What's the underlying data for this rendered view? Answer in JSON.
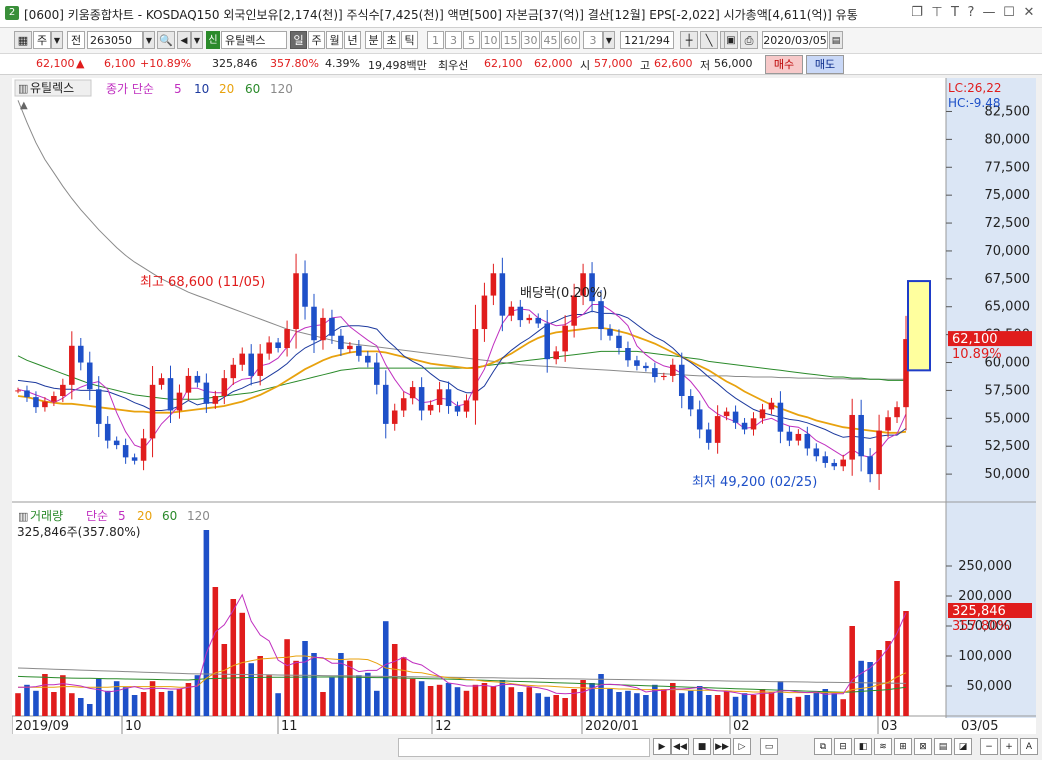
{
  "window": {
    "badge": "2",
    "title": "[0600] 키움종합차트 - KOSDAQ150 외국인보유[2,174(천)] 주식수[7,425(천)] 액면[500] 자본금[37(억)] 결산[12월] EPS[-2,022] 시가총액[4,611(억)] 유통"
  },
  "toolbar": {
    "period_unit": "주",
    "all": "전",
    "code": "263050",
    "credit": "신",
    "stock_name": "유틸렉스",
    "tabs": [
      "일",
      "주",
      "월",
      "년",
      "분",
      "초",
      "틱"
    ],
    "minutes": [
      "1",
      "3",
      "5",
      "10",
      "15",
      "30",
      "45",
      "60"
    ],
    "custom_min": "3",
    "count": "121/294",
    "date": "2020/03/05"
  },
  "info": {
    "price": "62,100",
    "change": "6,100",
    "change_pct": "+10.89%",
    "volume": "325,846",
    "volume_pct": "357.80%",
    "turnover": "4.39%",
    "amount": "19,498백만",
    "best_label": "최우선",
    "ask": "62,100",
    "bid": "62,000",
    "open_label": "시",
    "open": "57,000",
    "high_label": "고",
    "high": "62,600",
    "low_label": "저",
    "low": "56,000",
    "buy": "매수",
    "sell": "매도"
  },
  "colors": {
    "up": "#e01c1c",
    "down": "#1e50c8",
    "ma5": "#c030c0",
    "ma10": "#1d3a9e",
    "ma20": "#e8a20e",
    "ma60": "#2a8a2a",
    "ma120": "#8a8a8a"
  },
  "chart_data": [
    {
      "type": "candlestick",
      "title": "유틸렉스",
      "legend": {
        "base": "종가 단순",
        "periods": [
          "5",
          "10",
          "20",
          "60",
          "120"
        ]
      },
      "right_labels": {
        "lc": "LC:26,22",
        "hc": "HC:-9.48"
      },
      "last_price_tag": "62,100",
      "last_pct_tag": "10.89%",
      "annotations": {
        "high": "최고 68,600 (11/05)",
        "low": "최저 49,200 (02/25)",
        "dividend": "배당락(0.20%)"
      },
      "yticks": [
        50000,
        52500,
        55000,
        57500,
        60000,
        62500,
        65000,
        67500,
        70000,
        72500,
        75000,
        77500,
        80000,
        82500
      ],
      "ytick_labels": [
        "50,000",
        "52,500",
        "55,000",
        "57,500",
        "60,000",
        "62,500",
        "65,000",
        "67,500",
        "70,000",
        "72,500",
        "75,000",
        "77,500",
        "80,000",
        "82,500"
      ],
      "ylim": [
        47500,
        85500
      ],
      "close": [
        57500,
        56900,
        56000,
        56500,
        57000,
        58000,
        61500,
        60000,
        57600,
        54500,
        53000,
        52600,
        51500,
        51200,
        53200,
        58000,
        58600,
        55700,
        57300,
        58800,
        58200,
        56300,
        57000,
        58600,
        59800,
        60800,
        58800,
        60800,
        61800,
        61300,
        63000,
        68000,
        65000,
        62000,
        64000,
        62400,
        61200,
        61500,
        60600,
        60000,
        58000,
        54500,
        55700,
        56800,
        57800,
        55700,
        56200,
        57600,
        56100,
        55600,
        56600,
        63000,
        66000,
        68000,
        64200,
        65000,
        63800,
        64000,
        63500,
        60300,
        61000,
        63300,
        66000,
        68000,
        65500,
        63000,
        62400,
        61300,
        60200,
        59700,
        59500,
        58700,
        58800,
        59800,
        57000,
        55800,
        54000,
        52800,
        55200,
        55600,
        54600,
        54000,
        55000,
        55800,
        56400,
        53800,
        53000,
        53600,
        52300,
        51600,
        51000,
        50700,
        51300,
        55300,
        51600,
        50000,
        53900,
        55100,
        56000,
        62100
      ],
      "ma5": [
        57600,
        57400,
        57100,
        56800,
        56400,
        56800,
        57400,
        57800,
        58100,
        58300,
        57600,
        55500,
        53800,
        52600,
        52300,
        53300,
        54500,
        55300,
        56200,
        57700,
        57700,
        57400,
        57300,
        57300,
        58100,
        58500,
        58600,
        59700,
        59900,
        60400,
        61400,
        62700,
        63100,
        63300,
        63400,
        64000,
        64100,
        63200,
        62600,
        62000,
        61500,
        59800,
        58500,
        57400,
        57000,
        56400,
        56500,
        56800,
        56700,
        56100,
        56300,
        58000,
        59400,
        61600,
        63500,
        64600,
        64800,
        64700,
        64000,
        63600,
        63300,
        63400,
        63900,
        64300,
        65200,
        65200,
        64700,
        64100,
        63300,
        61500,
        60700,
        60100,
        59700,
        59500,
        59000,
        58300,
        57300,
        56000,
        55400,
        55000,
        54700,
        54100,
        54200,
        54800,
        55000,
        54600,
        54300,
        54200,
        53700,
        53000,
        52600,
        52100,
        51600,
        52200,
        51700,
        51500,
        52200,
        53200,
        53600,
        55400
      ],
      "ma10": [
        58400,
        58300,
        58200,
        57900,
        57700,
        57600,
        57600,
        57500,
        57500,
        57500,
        57400,
        57100,
        56800,
        56400,
        56100,
        55700,
        55700,
        55800,
        56100,
        56600,
        56200,
        56400,
        56400,
        56900,
        57400,
        57700,
        58100,
        58300,
        58800,
        59300,
        59900,
        60700,
        61300,
        61700,
        62100,
        62700,
        63200,
        63300,
        63300,
        63200,
        63000,
        62100,
        61400,
        60600,
        60100,
        59700,
        59000,
        58400,
        58200,
        57600,
        57300,
        57300,
        57900,
        59200,
        60400,
        61100,
        61700,
        62200,
        62800,
        63400,
        63700,
        64100,
        64300,
        64300,
        64600,
        64400,
        64400,
        64300,
        64000,
        63400,
        62800,
        62300,
        61900,
        61300,
        60500,
        60000,
        59400,
        58700,
        58100,
        57400,
        56800,
        56300,
        55800,
        55500,
        55300,
        55100,
        54900,
        54800,
        54600,
        54300,
        54000,
        53600,
        53300,
        53400,
        53300,
        53200,
        53400,
        53500,
        53500,
        54100
      ],
      "ma20": [
        57000,
        56900,
        56700,
        56500,
        56400,
        56300,
        56300,
        56200,
        56100,
        56000,
        55900,
        55800,
        55700,
        55600,
        55600,
        55500,
        55500,
        55500,
        55600,
        55700,
        55800,
        55900,
        56000,
        56100,
        56300,
        56500,
        56800,
        57100,
        57500,
        57900,
        58400,
        58900,
        59400,
        59800,
        60200,
        60500,
        60700,
        60900,
        61000,
        61000,
        61000,
        60900,
        60700,
        60500,
        60300,
        60100,
        59900,
        59800,
        59700,
        59600,
        59500,
        59500,
        59700,
        60000,
        60400,
        60800,
        61300,
        61800,
        62200,
        62500,
        62700,
        62800,
        62900,
        63000,
        63100,
        63100,
        63000,
        62800,
        62600,
        62300,
        62000,
        61700,
        61300,
        60900,
        60500,
        60100,
        59700,
        59300,
        58800,
        58300,
        57900,
        57400,
        57000,
        56600,
        56200,
        55900,
        55600,
        55300,
        55100,
        54800,
        54600,
        54400,
        54200,
        54100,
        54000,
        53900,
        53800,
        53700,
        53700,
        53800
      ],
      "ma60": [
        60600,
        60200,
        59900,
        59600,
        59300,
        59000,
        58700,
        58400,
        58100,
        57900,
        57700,
        57500,
        57300,
        57100,
        57000,
        56900,
        56800,
        56700,
        56700,
        56700,
        56700,
        56800,
        56900,
        57000,
        57100,
        57200,
        57300,
        57500,
        57700,
        57900,
        58100,
        58300,
        58500,
        58700,
        58900,
        59100,
        59300,
        59400,
        59500,
        59500,
        59500,
        59500,
        59500,
        59500,
        59500,
        59500,
        59500,
        59500,
        59500,
        59500,
        59500,
        59600,
        59700,
        59800,
        59900,
        60000,
        60100,
        60200,
        60300,
        60400,
        60500,
        60600,
        60700,
        60800,
        60900,
        61000,
        61000,
        61000,
        61000,
        61000,
        60900,
        60800,
        60700,
        60600,
        60500,
        60400,
        60300,
        60100,
        60000,
        59900,
        59800,
        59700,
        59600,
        59500,
        59400,
        59300,
        59200,
        59100,
        59000,
        58900,
        58800,
        58700,
        58700,
        58600,
        58600,
        58500,
        58500,
        58400,
        58400,
        58400
      ],
      "ma120": [
        83500,
        81500,
        79700,
        78200,
        77000,
        75800,
        74700,
        73700,
        72800,
        71900,
        71100,
        70300,
        69600,
        69000,
        68500,
        68000,
        67500,
        67100,
        66700,
        66300,
        66000,
        65700,
        65400,
        65100,
        64800,
        64500,
        64200,
        63900,
        63600,
        63300,
        63000,
        62800,
        62600,
        62400,
        62200,
        62000,
        61800,
        61700,
        61600,
        61500,
        61400,
        61300,
        61200,
        61100,
        61000,
        60900,
        60800,
        60700,
        60600,
        60500,
        60400,
        60300,
        60200,
        60100,
        60000,
        59900,
        59800,
        59750,
        59700,
        59650,
        59600,
        59550,
        59500,
        59450,
        59400,
        59350,
        59300,
        59250,
        59200,
        59150,
        59100,
        59050,
        59000,
        58950,
        58900,
        58850,
        58800,
        58800,
        58800,
        58800,
        58750,
        58750,
        58700,
        58700,
        58700,
        58650,
        58650,
        58600,
        58600,
        58600,
        58550,
        58550,
        58550,
        58500,
        58500,
        58500,
        58500,
        58500,
        58500,
        58500
      ]
    },
    {
      "type": "bar",
      "title": "거래량",
      "legend": {
        "base": "단순",
        "periods": [
          "5",
          "20",
          "60",
          "120"
        ]
      },
      "value_label": "325,846주(357.80%)",
      "last_value_tag": "325,846",
      "last_pct_tag": "357.80%",
      "xlabels": [
        "2019/09",
        "10",
        "11",
        "12",
        "2020/01",
        "02",
        "03",
        "03/05"
      ],
      "yticks": [
        50000,
        100000,
        150000,
        200000,
        250000
      ],
      "ytick_labels": [
        "50,000",
        "100,000",
        "150,000",
        "200,000",
        "250,000"
      ],
      "ylim": [
        0,
        330000
      ],
      "values": [
        38000,
        52000,
        42000,
        70000,
        40000,
        68000,
        38000,
        30000,
        20000,
        62000,
        42000,
        58000,
        48000,
        35000,
        40000,
        58000,
        40000,
        42000,
        45000,
        55000,
        68000,
        310000,
        215000,
        120000,
        195000,
        172000,
        88000,
        100000,
        68000,
        38000,
        128000,
        92000,
        125000,
        105000,
        40000,
        64000,
        105000,
        92000,
        68000,
        72000,
        42000,
        158000,
        120000,
        98000,
        62000,
        58000,
        50000,
        52000,
        55000,
        48000,
        42000,
        52000,
        55000,
        50000,
        60000,
        48000,
        40000,
        48000,
        38000,
        32000,
        35000,
        30000,
        45000,
        60000,
        55000,
        70000,
        45000,
        40000,
        42000,
        38000,
        35000,
        52000,
        45000,
        55000,
        38000,
        42000,
        50000,
        35000,
        35000,
        42000,
        32000,
        38000,
        35000,
        45000,
        40000,
        58000,
        30000,
        32000,
        35000,
        40000,
        45000,
        38000,
        28000,
        150000,
        92000,
        90000,
        110000,
        125000,
        225000,
        175000
      ],
      "ma5": [
        48000,
        48000,
        49000,
        52000,
        52000,
        54000,
        52000,
        50000,
        46000,
        44000,
        40000,
        42000,
        46000,
        49000,
        45000,
        46000,
        46000,
        45000,
        45000,
        48000,
        50000,
        105000,
        140000,
        152000,
        176000,
        202000,
        158000,
        135000,
        125000,
        93000,
        84000,
        89000,
        90000,
        98000,
        97000,
        88000,
        88000,
        82000,
        74000,
        76000,
        76000,
        86000,
        91000,
        98000,
        89000,
        85000,
        75000,
        66000,
        55000,
        53000,
        50000,
        50000,
        51000,
        49000,
        52000,
        53000,
        51000,
        49000,
        47000,
        44000,
        38000,
        37000,
        38000,
        40000,
        46000,
        52000,
        53000,
        52000,
        50000,
        47000,
        40000,
        42000,
        43000,
        45000,
        45000,
        46000,
        48000,
        44000,
        42000,
        41000,
        39000,
        36000,
        36000,
        38000,
        38000,
        42000,
        42000,
        40000,
        39000,
        40000,
        36000,
        37000,
        37000,
        60000,
        71000,
        80000,
        94000,
        113000,
        138000,
        172000
      ],
      "ma20": [
        48000,
        48000,
        48000,
        48000,
        48000,
        49000,
        49000,
        48000,
        48000,
        48000,
        48000,
        49000,
        49000,
        49000,
        49000,
        49000,
        49000,
        49000,
        48000,
        48000,
        50000,
        63000,
        72000,
        76000,
        84000,
        89000,
        92000,
        95000,
        96000,
        97000,
        98000,
        100000,
        100000,
        98000,
        96000,
        95000,
        94000,
        95000,
        95000,
        94000,
        88000,
        80000,
        78000,
        76000,
        73000,
        72000,
        69000,
        66000,
        64000,
        63000,
        61000,
        60000,
        58000,
        57000,
        56000,
        54000,
        52000,
        51000,
        50000,
        50000,
        49000,
        48000,
        47000,
        47000,
        46000,
        46000,
        46000,
        45000,
        45000,
        44000,
        44000,
        44000,
        44000,
        44000,
        44000,
        43000,
        43000,
        43000,
        42000,
        42000,
        41000,
        41000,
        40000,
        40000,
        40000,
        40000,
        39000,
        39000,
        39000,
        39000,
        39000,
        39000,
        39000,
        44000,
        46000,
        48000,
        52000,
        56000,
        65000,
        72000
      ],
      "ma60": [
        66000,
        65500,
        65000,
        64500,
        64000,
        63500,
        63200,
        63000,
        62800,
        62500,
        62200,
        62000,
        61700,
        61500,
        61200,
        61000,
        60700,
        60500,
        60200,
        60000,
        61000,
        62000,
        62500,
        63000,
        63500,
        64000,
        64200,
        64400,
        64500,
        64600,
        64700,
        64800,
        64900,
        65000,
        65000,
        65000,
        65000,
        64800,
        64500,
        64200,
        64000,
        63800,
        63500,
        63200,
        62800,
        62500,
        62200,
        61800,
        61500,
        61000,
        60500,
        60000,
        59500,
        59000,
        58500,
        58000,
        57500,
        57000,
        56500,
        56000,
        55500,
        55000,
        54500,
        54000,
        53500,
        53000,
        52500,
        52000,
        51500,
        51000,
        50500,
        50000,
        49500,
        49000,
        48500,
        48000,
        47500,
        47000,
        46500,
        46000,
        45500,
        45000,
        44500,
        44000,
        43500,
        43000,
        42500,
        42000,
        41500,
        41000,
        40500,
        40000,
        39500,
        40000,
        41000,
        42000,
        43000,
        44000,
        46000,
        48000
      ],
      "ma120": [
        80000,
        79500,
        79000,
        78500,
        78000,
        77500,
        77000,
        76500,
        76000,
        75500,
        75000,
        74500,
        74000,
        73500,
        73000,
        72500,
        72000,
        71500,
        71000,
        70500,
        70200,
        70000,
        69800,
        69600,
        69400,
        69200,
        69000,
        68800,
        68600,
        68400,
        68200,
        68000,
        67800,
        67600,
        67400,
        67200,
        67000,
        66800,
        66600,
        66400,
        66200,
        66000,
        65800,
        65600,
        65400,
        65200,
        65000,
        64800,
        64600,
        64400,
        64200,
        64000,
        63800,
        63600,
        63400,
        63200,
        63000,
        62800,
        62600,
        62400,
        62200,
        62000,
        61800,
        61600,
        61400,
        61200,
        61000,
        60800,
        60600,
        60400,
        60200,
        60000,
        59800,
        59600,
        59400,
        59200,
        59000,
        58800,
        58600,
        58400,
        58200,
        58000,
        57800,
        57600,
        57400,
        57200,
        57000,
        56800,
        56600,
        56400,
        56200,
        56000,
        55800,
        55600,
        55400,
        55200,
        55000,
        54800,
        54600,
        54400
      ]
    }
  ]
}
